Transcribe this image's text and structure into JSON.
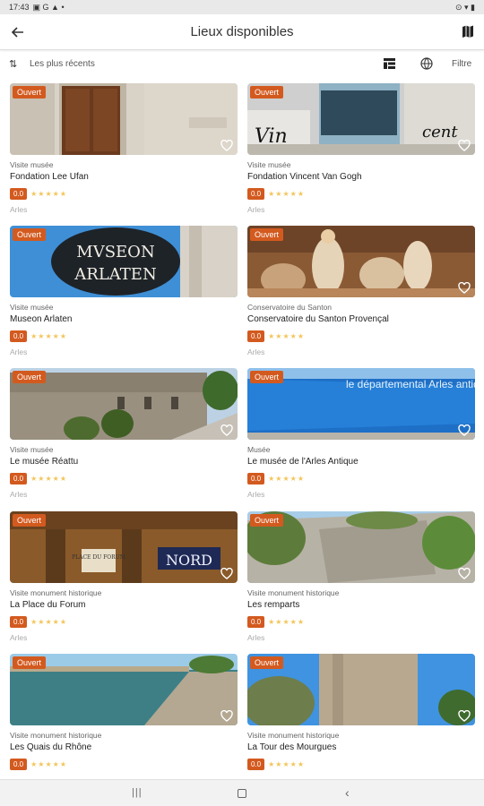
{
  "status": {
    "time": "17:43",
    "left_icons": "▣ G ▲ •",
    "right_icons": "⊙ ▾ ▮"
  },
  "header": {
    "title": "Lieux disponibles",
    "back_icon": "arrow-left-icon",
    "map_icon": "map-icon"
  },
  "toolbar": {
    "sort_label": "Les plus récents",
    "filter_label": "Filtre"
  },
  "badge_label": "Ouvert",
  "places": [
    {
      "status": "Ouvert",
      "category": "Visite musée",
      "name": "Fondation Lee Ufan",
      "score": "0.0",
      "stars": "★★★★★",
      "city": "Arles"
    },
    {
      "status": "Ouvert",
      "category": "Visite musée",
      "name": "Fondation Vincent Van Gogh",
      "score": "0.0",
      "stars": "★★★★★",
      "city": "Arles"
    },
    {
      "status": "Ouvert",
      "category": "Visite musée",
      "name": "Museon Arlaten",
      "score": "0.0",
      "stars": "★★★★★",
      "city": "Arles"
    },
    {
      "status": "Ouvert",
      "category": "Conservatoire du Santon",
      "name": "Conservatoire du Santon Provençal",
      "score": "0.0",
      "stars": "★★★★★",
      "city": "Arles"
    },
    {
      "status": "Ouvert",
      "category": "Visite musée",
      "name": "Le musée Réattu",
      "score": "0.0",
      "stars": "★★★★★",
      "city": "Arles"
    },
    {
      "status": "Ouvert",
      "category": "Musée",
      "name": "Le musée de l'Arles Antique",
      "score": "0.0",
      "stars": "★★★★★",
      "city": "Arles"
    },
    {
      "status": "Ouvert",
      "category": "Visite monument historique",
      "name": "La Place du Forum",
      "score": "0.0",
      "stars": "★★★★★",
      "city": "Arles"
    },
    {
      "status": "Ouvert",
      "category": "Visite monument historique",
      "name": "Les remparts",
      "score": "0.0",
      "stars": "★★★★★",
      "city": "Arles"
    },
    {
      "status": "Ouvert",
      "category": "Visite monument historique",
      "name": "Les Quais du Rhône",
      "score": "0.0",
      "stars": "★★★★★",
      "city": ""
    },
    {
      "status": "Ouvert",
      "category": "Visite monument historique",
      "name": "La Tour des Mourgues",
      "score": "0.0",
      "stars": "★★★★★",
      "city": ""
    }
  ],
  "image_text": {
    "van_gogh_left": "Vin",
    "van_gogh_right": "cent",
    "arlaten_line1": "MVSEON",
    "arlaten_line2": "ARLATEN",
    "antique_wall": "le départemental Arles antique",
    "forum_sign": "PLACE DU FORUM",
    "forum_neon": "NORD"
  },
  "colors": {
    "accent": "#d35a1f",
    "star": "#f3c55a"
  }
}
